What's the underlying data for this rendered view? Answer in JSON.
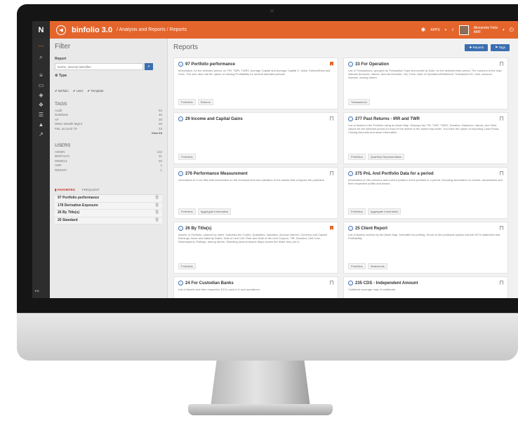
{
  "colors": {
    "accent": "#e4652c",
    "primary": "#3b6fb0",
    "rail": "#2d2d2d"
  },
  "topbar": {
    "logo": "N",
    "app_title": "binfolio 3.0",
    "breadcrumb": "/ Analysis and Reports / Reports",
    "apps_label": "APPS",
    "user_name": "Alexandre Felix",
    "user_org": "AMF",
    "icons": [
      "back-icon",
      "apps-icon",
      "bell-icon",
      "power-icon"
    ]
  },
  "rail": {
    "bottom_label": "EN"
  },
  "filter": {
    "title": "Filter",
    "report_label": "Report",
    "search_placeholder": "Name, Internal Identifier",
    "type_label": "Type",
    "types": [
      "Binfolio",
      "User",
      "Template"
    ],
    "tags_title": "TAGS",
    "tags": [
      {
        "name": "Audit",
        "count": "62"
      },
      {
        "name": "Database",
        "count": "45"
      },
      {
        "name": "AF",
        "count": "30"
      },
      {
        "name": "WMU Wealth Mgmt",
        "count": "26"
      },
      {
        "name": "P&L account 79",
        "count": "23"
      }
    ],
    "view_all": "View All",
    "users_title": "USERS",
    "users": [
      {
        "name": "ADMIN",
        "count": "132"
      },
      {
        "name": "BINFOLIO",
        "count": "31"
      },
      {
        "name": "0000513",
        "count": "20"
      },
      {
        "name": "AMF",
        "count": "1"
      },
      {
        "name": "0001827",
        "count": "1"
      }
    ],
    "tab_favorites": "FAVORITES",
    "tab_frequent": "FREQUENT",
    "favorites": [
      "97 Portfolio performance",
      "178 Derivative Exposure",
      "26 By Title(s)",
      "20 Standard"
    ]
  },
  "reports": {
    "title": "Reports",
    "btn_reports": "Reports",
    "btn_tags": "Tags",
    "cards": [
      {
        "num": "97",
        "title": "97 Portfolio performance",
        "bookmarked": true,
        "desc": "Information, for the selected period, on TIR, TWR, TWR2, Average Capital and Average Capital X. Value, Entries/Exits and Fees. The user also has the option of viewing Profitability for several standard periods.",
        "tags": [
          "Portfolios",
          "Returns"
        ]
      },
      {
        "num": "33",
        "title": "33 For Operation",
        "bookmarked": false,
        "desc": "List of Transactions, grouped by Transaction Type and sorted by Date, for the selected time period. The columns of the map indicate Amounts, Values, Accrual Interests, Tax, Fees, Date of Operation/Settlement, Transaction ID, User, Account Number, among others.",
        "tags": [
          "Transactions"
        ]
      },
      {
        "num": "29",
        "title": "29 Income and Capital Gains",
        "bookmarked": false,
        "desc": "",
        "tags": [
          "Portfolios"
        ]
      },
      {
        "num": "277",
        "title": "277 Past Returns - IRR and TWR",
        "bookmarked": false,
        "desc": "List of Assets in the Portfolio using an Asset Map. Displays the TIR, TWR, TWR2, Duration, Balances, Values, and Yield values for the selected period for each of the assets in the asset map folder. You have the option of exporting Cash Flows, Closing Amounts and asset information.",
        "tags": [
          "Portfolios",
          "Quarterly Representation"
        ]
      },
      {
        "num": "276",
        "title": "276 Performance Measurement",
        "bookmarked": false,
        "desc": "Generation of 3 csv files with information on the technical fees and valuation of the assets that compose the portfolios.",
        "tags": [
          "Portfolios",
          "Aggregate Information"
        ]
      },
      {
        "num": "275",
        "title": "275 PnL And Portfolio Data for a period",
        "bookmarked": false,
        "desc": "Information on the previous and current position of the portfolio in a period, including information on events, transactions and their respective profits and losses.",
        "tags": [
          "Portfolios",
          "Aggregate Information"
        ]
      },
      {
        "num": "26",
        "title": "26 By Title(s)",
        "bookmarked": true,
        "desc": "Assets, in Portfolio, ordered by name. Indicates the Codes, Quantities, Valuation, Accrual Interest, Currency and Capital Earnings, Issue and Maturity Dates, Date of next Coll, Rate and Date of the next Coupon, TIR, Duration, Unit Cost, Redemptions, Ratings, among others. Selecting several Assets Maps shows the folder they are in.",
        "tags": [
          "Portfolios"
        ]
      },
      {
        "num": "25",
        "title": "25 Client Report",
        "bookmarked": false,
        "desc": "List of Assets ordered by the Asset Map, formatted for printing. Some of the positional options include DCI's statement and Profitability.",
        "tags": [
          "Portfolios",
          "Statements"
        ]
      },
      {
        "num": "24",
        "title": "24 For Custodian Banks",
        "bookmarked": false,
        "desc": "List of Assets and their respective DCI's used in it own operations.",
        "tags": []
      },
      {
        "num": "235",
        "title": "235 CDS - Independent Amount",
        "bookmarked": false,
        "desc": "Collateral coverage map of collaterals.",
        "tags": []
      }
    ]
  }
}
